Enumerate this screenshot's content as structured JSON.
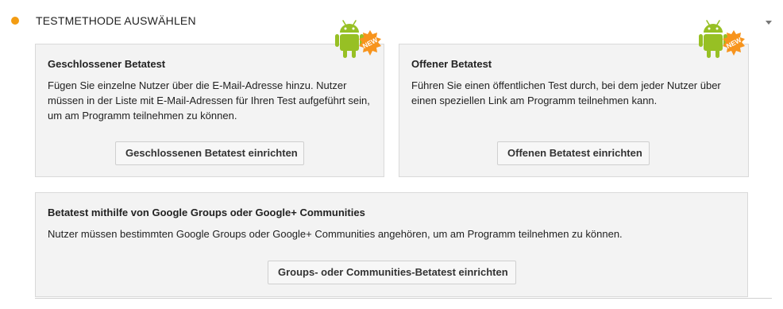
{
  "section": {
    "title": "TESTMETHODE AUSWÄHLEN"
  },
  "cards": {
    "closed": {
      "title": "Geschlossener Betatest",
      "description": "Fügen Sie einzelne Nutzer über die E-Mail-Adresse hinzu. Nutzer müssen in der Liste mit E-Mail-Adressen für Ihren Test aufgeführt sein, um am Programm teilnehmen zu können.",
      "button": "Geschlossenen Betatest einrichten",
      "badge": "NEW"
    },
    "open": {
      "title": "Offener Betatest",
      "description": "Führen Sie einen öffentlichen Test durch, bei dem jeder Nutzer über einen speziellen Link am Programm teilnehmen kann.",
      "button": "Offenen Betatest einrichten",
      "badge": "NEW"
    },
    "groups": {
      "title": "Betatest mithilfe von Google Groups oder Google+ Communities",
      "description": "Nutzer müssen bestimmten Google Groups oder Google+ Communities angehören, um am Programm teilnehmen zu können.",
      "button": "Groups- oder Communities-Betatest einrichten"
    }
  },
  "colors": {
    "status_dot": "#f39c12",
    "android_green": "#97c024",
    "new_badge": "#f7941d"
  },
  "icons": {
    "status": "status-dot-icon",
    "collapse": "chevron-down-icon",
    "badge": "android-new-badge-icon"
  }
}
